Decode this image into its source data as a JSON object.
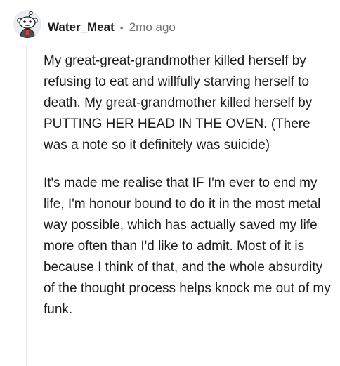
{
  "comment": {
    "author": {
      "username": "Water_Meat",
      "avatar_icon": "snoo-avatar-icon"
    },
    "separator": "•",
    "timestamp": "2mo ago",
    "paragraphs": [
      "My great-great-grandmother killed herself by refusing to eat and willfully starving herself to death. My great-grandmother killed herself by PUTTING HER HEAD IN THE OVEN. (There was a note so it definitely was suicide)",
      "It's made me realise that IF I'm ever to end my life, I'm honour bound to do it in the most metal way possible, which has actually saved my life more often than I'd like to admit. Most of it is because I think of that, and the whole absurdity of the thought process helps knock me out of my funk."
    ]
  },
  "colors": {
    "text": "#1c1c1c",
    "meta": "#6f7376",
    "thread_line": "#e6e8ea",
    "avatar_bg": "#e9edf0"
  }
}
